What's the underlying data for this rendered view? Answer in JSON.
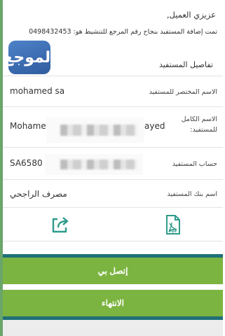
{
  "header": {
    "greeting": "عزيزي العميل,",
    "success_message": "تمت إضافة المستفيد بنجاح رقم المرجع للتنشيط هو: 0498432453"
  },
  "logo": {
    "text": "الموجع"
  },
  "details": {
    "section_title": "تفاصيل المستفيد",
    "rows": [
      {
        "label": "الاسم المختصر للمستفيد",
        "value": "mohamed sa"
      },
      {
        "label": "الاسم الكامل للمستفيد:",
        "value_start": "Mohame",
        "value_end": "ayed"
      },
      {
        "label": "حساب المستفيد",
        "value": "SA6580"
      },
      {
        "label": "اسم بنك المستفيد",
        "value": "مصرف الراجحي"
      }
    ]
  },
  "actions": {
    "share_icon": "share-export-icon",
    "pdf_icon": "pdf-file-icon",
    "pdf_label": "PDF"
  },
  "buttons": {
    "call_me": "إتصل بي",
    "finish": "الانتهاء"
  },
  "colors": {
    "primary_green": "#7cb441",
    "icon_green": "#2e9a8a",
    "stripe_teal": "#1f6f78"
  }
}
